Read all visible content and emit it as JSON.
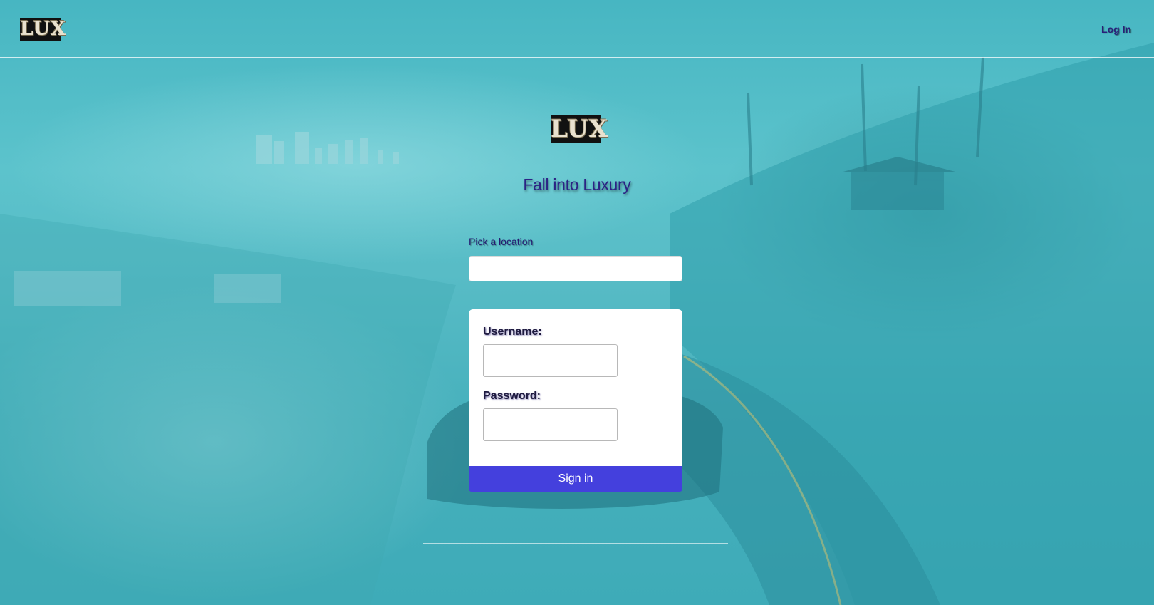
{
  "header": {
    "logo_text": "LUX",
    "login_link": "Log In"
  },
  "hero": {
    "logo_text": "LUX",
    "tagline": "Fall into Luxury"
  },
  "location": {
    "label": "Pick a location",
    "value": "",
    "placeholder": ""
  },
  "login_form": {
    "username_label": "Username:",
    "username_value": "",
    "password_label": "Password:",
    "password_value": "",
    "signin_label": "Sign in"
  },
  "colors": {
    "accent": "#4440dd",
    "heading": "#2c2385",
    "background": "#4fb8c3"
  }
}
